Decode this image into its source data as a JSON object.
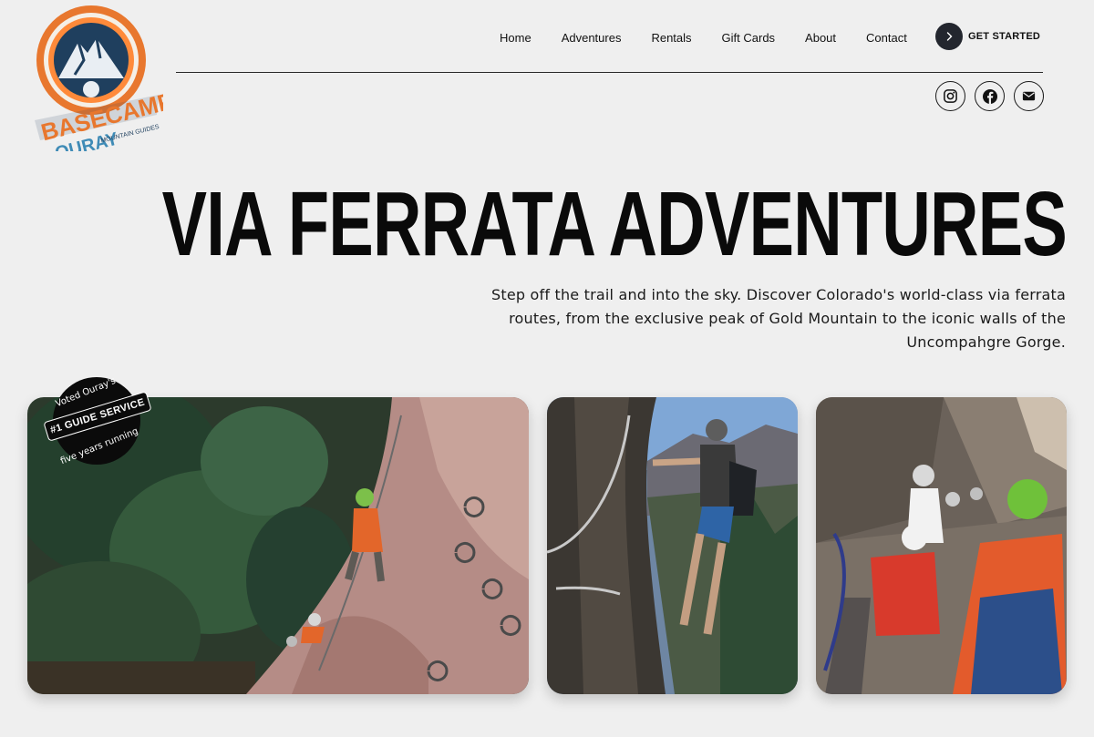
{
  "brand": {
    "logo_top": "BASECAMP",
    "logo_bottom": "OURAY",
    "logo_tag": "MOUNTAIN GUIDES",
    "colors": {
      "orange": "#e8772e",
      "navy": "#1f3f5e",
      "sky": "#3f8bb6"
    }
  },
  "nav": {
    "items": [
      {
        "label": "Home"
      },
      {
        "label": "Adventures"
      },
      {
        "label": "Rentals"
      },
      {
        "label": "Gift Cards"
      },
      {
        "label": "About"
      },
      {
        "label": "Contact"
      }
    ],
    "cta_label": "GET STARTED",
    "cta_icon": "chevron-right-icon"
  },
  "social": [
    {
      "icon": "instagram-icon"
    },
    {
      "icon": "facebook-icon"
    },
    {
      "icon": "mail-icon"
    }
  ],
  "hero": {
    "title": "VIA FERRATA ADVENTURES",
    "subtitle": "Step off the trail and into the sky. Discover Colorado's world-class via ferrata routes, from the exclusive peak of Gold Mountain to the iconic walls of the Uncompahgre Gorge."
  },
  "badge": {
    "top": "Voted Ouray's",
    "main": "#1 GUIDE SERVICE",
    "bottom": "five years running"
  },
  "photos": [
    {
      "subject": "aerial-climbers-on-rock-wall"
    },
    {
      "subject": "climber-on-cliff-ledge"
    },
    {
      "subject": "family-climbing-group"
    }
  ]
}
